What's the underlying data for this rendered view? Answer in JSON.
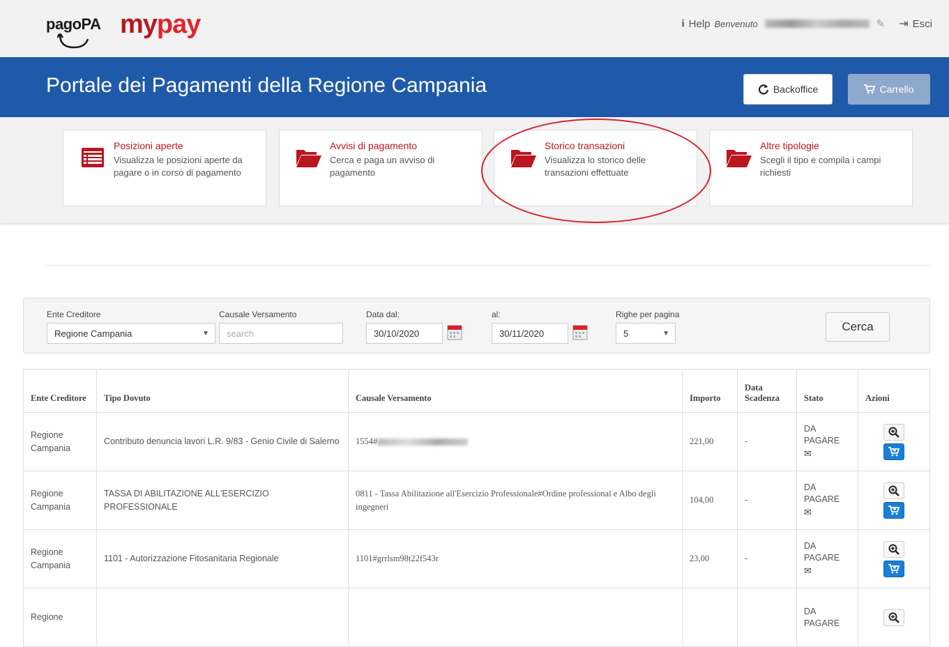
{
  "topbar": {
    "logo_pagopa": "pagoPA",
    "logo_mypay_my": "my",
    "logo_mypay_pay": "pay",
    "help_icon": "info-icon",
    "help_label": "Help",
    "welcome_label": "Benvenuto",
    "logout_label": "Esci"
  },
  "header": {
    "title": "Portale dei Pagamenti della Regione Campania",
    "backoffice_label": "Backoffice",
    "cart_label": "Carrello"
  },
  "cards": [
    {
      "title": "Posizioni aperte",
      "desc": "Visualizza le posizioni aperte da pagare o in corso di pagamento",
      "icon": "list-icon"
    },
    {
      "title": "Avvisi di pagamento",
      "desc": "Cerca e paga un avviso di pagamento",
      "icon": "folder-open-icon"
    },
    {
      "title": "Storico transazioni",
      "desc": "Visualizza lo storico delle transazioni effettuate",
      "icon": "folder-open-icon"
    },
    {
      "title": "Altre tipologie",
      "desc": "Scegli il tipo e compila i campi richiesti",
      "icon": "folder-open-icon"
    }
  ],
  "filters": {
    "ente_label": "Ente Creditore",
    "ente_value": "Regione Campania",
    "causale_label": "Causale Versamento",
    "causale_placeholder": "search",
    "data_dal_label": "Data dal:",
    "data_dal_value": "30/10/2020",
    "data_al_label": "al:",
    "data_al_value": "30/11/2020",
    "righe_label": "Righe per pagina",
    "righe_value": "5",
    "cerca_label": "Cerca"
  },
  "table": {
    "headers": {
      "ente": "Ente Creditore",
      "tipo": "Tipo Dovuto",
      "causale": "Causale Versamento",
      "importo": "Importo",
      "scadenza": "Data Scadenza",
      "stato": "Stato",
      "azioni": "Azioni"
    },
    "rows": [
      {
        "ente": "Regione Campania",
        "tipo": "Contributo denuncia lavori L.R. 9/83 - Genio Civile di Salerno",
        "causale": "1554#",
        "importo": "221,00",
        "scadenza": "-",
        "stato": "DA PAGARE"
      },
      {
        "ente": "Regione Campania",
        "tipo": "TASSA DI ABILITAZIONE ALL'ESERCIZIO PROFESSIONALE",
        "causale": "0811 - Tassa Abilitazione all'Esercizio Professionale#Ordine professional e Albo degli ingegneri",
        "importo": "104,00",
        "scadenza": "-",
        "stato": "DA PAGARE"
      },
      {
        "ente": "Regione Campania",
        "tipo": "1101 - Autorizzazione Fitosanitaria Regionale",
        "causale": "1101#grrlsm98t22f543r",
        "importo": "23,00",
        "scadenza": "-",
        "stato": "DA PAGARE"
      },
      {
        "ente": "Regione",
        "tipo": "",
        "causale": "",
        "importo": "",
        "scadenza": "",
        "stato": "DA PAGARE"
      }
    ]
  },
  "colors": {
    "brand_blue": "#1f5aaa",
    "brand_red": "#b8171f",
    "cart_button": "#1a7fd6",
    "highlight_ellipse": "#d9202a"
  }
}
